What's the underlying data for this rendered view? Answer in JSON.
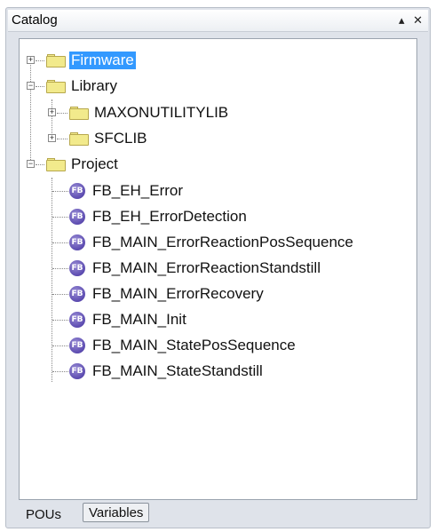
{
  "window": {
    "title": "Catalog",
    "pin_icon": "pin-icon",
    "close_icon": "close-icon"
  },
  "tree": {
    "firmware": "Firmware",
    "library": "Library",
    "library_children": [
      "MAXONUTILITYLIB",
      "SFCLIB"
    ],
    "project": "Project",
    "project_children": [
      "FB_EH_Error",
      "FB_EH_ErrorDetection",
      "FB_MAIN_ErrorReactionPosSequence",
      "FB_MAIN_ErrorReactionStandstill",
      "FB_MAIN_ErrorRecovery",
      "FB_MAIN_Init",
      "FB_MAIN_StatePosSequence",
      "FB_MAIN_StateStandstill"
    ],
    "fb_badge": "FB"
  },
  "tabs": {
    "pous": "POUs",
    "variables": "Variables"
  },
  "colors": {
    "selection": "#3399ff",
    "folder": "#f2ea8c",
    "fb_icon": "#5c4bb0"
  }
}
